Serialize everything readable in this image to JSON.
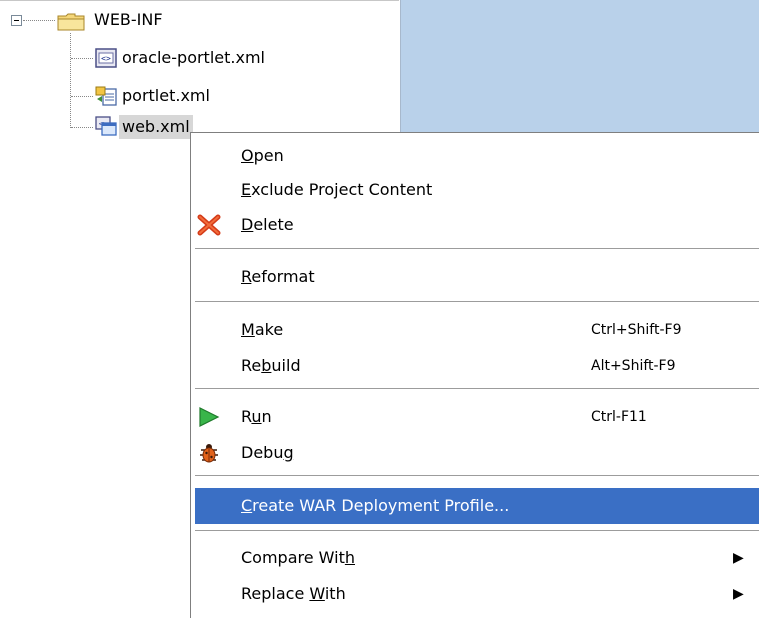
{
  "tree": {
    "root": {
      "label": "WEB-INF",
      "expanded": true
    },
    "children": [
      {
        "label": "oracle-portlet.xml",
        "icon": "xml-file-icon"
      },
      {
        "label": "portlet.xml",
        "icon": "portlet-xml-icon"
      },
      {
        "label": "web.xml",
        "icon": "web-xml-icon",
        "selected": true
      }
    ]
  },
  "context_menu": {
    "items": [
      {
        "id": "open",
        "label_pre": "",
        "mnemonic": "O",
        "label_post": "pen",
        "shortcut": ""
      },
      {
        "id": "exclude",
        "label_pre": "",
        "mnemonic": "E",
        "label_post": "xclude Project Content",
        "shortcut": ""
      },
      {
        "id": "delete",
        "label_pre": "",
        "mnemonic": "D",
        "label_post": "elete",
        "shortcut": "",
        "icon": "delete-x-icon"
      },
      {
        "id": "reformat",
        "label_pre": "",
        "mnemonic": "R",
        "label_post": "eformat",
        "shortcut": ""
      },
      {
        "id": "make",
        "label_pre": "",
        "mnemonic": "M",
        "label_post": "ake",
        "shortcut": "Ctrl+Shift-F9"
      },
      {
        "id": "rebuild",
        "label_pre": "Re",
        "mnemonic": "b",
        "label_post": "uild",
        "shortcut": "Alt+Shift-F9"
      },
      {
        "id": "run",
        "label_pre": "R",
        "mnemonic": "u",
        "label_post": "n",
        "shortcut": "Ctrl-F11",
        "icon": "run-play-icon"
      },
      {
        "id": "debug",
        "label_pre": "Debu",
        "mnemonic": "g",
        "label_post": "",
        "shortcut": "",
        "icon": "debug-bug-icon"
      },
      {
        "id": "create_war",
        "label_pre": "",
        "mnemonic": "C",
        "label_post": "reate WAR Deployment Profile...",
        "shortcut": "",
        "highlighted": true
      },
      {
        "id": "compare_with",
        "label_pre": "Compare Wit",
        "mnemonic": "h",
        "label_post": "",
        "shortcut": "",
        "submenu": "▶"
      },
      {
        "id": "replace_with",
        "label_pre": "Replace ",
        "mnemonic": "W",
        "label_post": "ith",
        "shortcut": "",
        "submenu": "▶"
      }
    ]
  },
  "colors": {
    "highlight": "#3a6fc5",
    "editor_background": "#b9d1ea",
    "selection_gray": "#d7d7d7"
  }
}
